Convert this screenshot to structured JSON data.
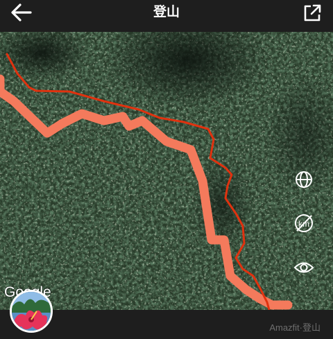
{
  "header": {
    "title": "登山",
    "back_icon": "arrow-left-icon",
    "share_icon": "share-external-icon"
  },
  "map": {
    "attribution": "Google",
    "controls": [
      "globe-icon",
      "km-unit-off-icon",
      "eye-icon"
    ],
    "colors": {
      "thick_track": "#f47a5c",
      "thin_track": "#e0320f",
      "forest": "#2a3d2b"
    }
  },
  "footer": {
    "watermark": "Amazfit·登山"
  },
  "colors": {
    "background": "#1e1e1e",
    "text": "#ffffff",
    "watermark": "#6e6e6e"
  }
}
